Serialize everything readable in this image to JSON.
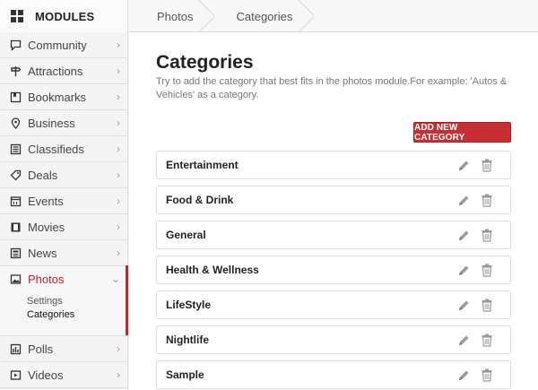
{
  "header": {
    "app_title": "MODULES",
    "breadcrumbs": [
      "Photos",
      "Categories"
    ]
  },
  "sidebar": {
    "items": [
      {
        "label": "Community",
        "icon": "comment-icon"
      },
      {
        "label": "Attractions",
        "icon": "signpost-icon"
      },
      {
        "label": "Bookmarks",
        "icon": "bookmark-icon"
      },
      {
        "label": "Business",
        "icon": "location-pin-icon"
      },
      {
        "label": "Classifieds",
        "icon": "list-icon"
      },
      {
        "label": "Deals",
        "icon": "tag-icon"
      },
      {
        "label": "Events",
        "icon": "calendar-icon"
      },
      {
        "label": "Movies",
        "icon": "film-icon"
      },
      {
        "label": "News",
        "icon": "newspaper-icon"
      },
      {
        "label": "Photos",
        "icon": "image-icon",
        "active": true
      },
      {
        "label": "Polls",
        "icon": "bar-chart-icon"
      },
      {
        "label": "Videos",
        "icon": "video-icon"
      }
    ],
    "photos_subnav": [
      "Settings",
      "Categories"
    ]
  },
  "main": {
    "title": "Categories",
    "description": "Try to add the category that best fits in the photos module.For example: 'Autos & Vehicles' as a category.",
    "add_button": "ADD NEW CATEGORY",
    "categories": [
      "Entertainment",
      "Food & Drink",
      "General",
      "Health & Wellness",
      "LifeStyle",
      "Nightlife",
      "Sample"
    ]
  },
  "colors": {
    "accent": "#c0272d",
    "button": "#c72f32"
  }
}
